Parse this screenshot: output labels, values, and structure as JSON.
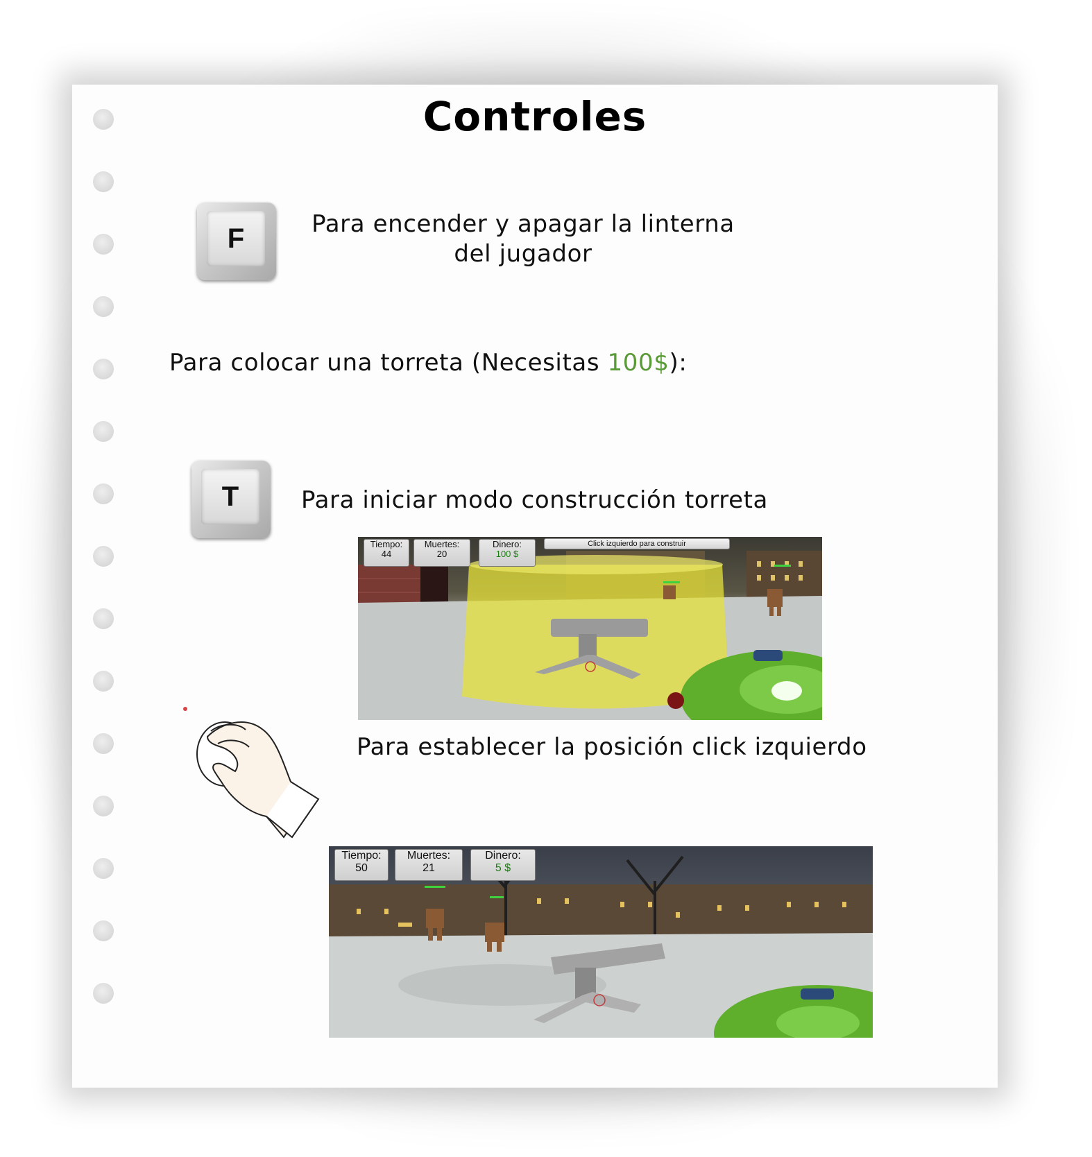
{
  "title": "Controles",
  "key_f": {
    "key": "F",
    "description_line1": "Para encender y apagar la linterna",
    "description_line2": "del jugador"
  },
  "turret_intro": {
    "text_before": "Para colocar una torreta (Necesitas ",
    "amount": "100$",
    "text_after": "):",
    "amount_color": "#5a9a37"
  },
  "key_t": {
    "key": "T",
    "description": "Para iniciar modo construcción torreta"
  },
  "mouse_instruction": "Para establecer la posición click izquierdo",
  "screenshot1": {
    "tiempo_label": "Tiempo:",
    "tiempo_value": "44",
    "muertes_label": "Muertes:",
    "muertes_value": "20",
    "dinero_label": "Dinero:",
    "dinero_value": "100 $",
    "prompt": "Click izquierdo para construir"
  },
  "screenshot2": {
    "tiempo_label": "Tiempo:",
    "tiempo_value": "50",
    "muertes_label": "Muertes:",
    "muertes_value": "21",
    "dinero_label": "Dinero:",
    "dinero_value": "5 $"
  },
  "icons": {
    "mouse": "hand-on-mouse-icon",
    "key_f": "keyboard-key-f-icon",
    "key_t": "keyboard-key-t-icon"
  }
}
